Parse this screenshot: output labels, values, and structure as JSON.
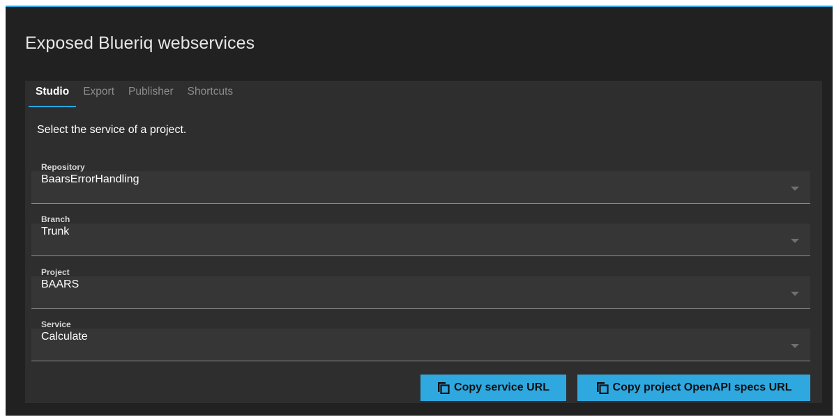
{
  "dialog": {
    "title": "Exposed Blueriq webservices"
  },
  "tabs": [
    {
      "label": "Studio",
      "active": true
    },
    {
      "label": "Export",
      "active": false
    },
    {
      "label": "Publisher",
      "active": false
    },
    {
      "label": "Shortcuts",
      "active": false
    }
  ],
  "studio": {
    "instruction": "Select the service of a project.",
    "fields": {
      "repository": {
        "label": "Repository",
        "value": "BaarsErrorHandling"
      },
      "branch": {
        "label": "Branch",
        "value": "Trunk"
      },
      "project": {
        "label": "Project",
        "value": "BAARS"
      },
      "service": {
        "label": "Service",
        "value": "Calculate"
      }
    },
    "buttons": {
      "copy_service_url": {
        "label": "Copy service URL",
        "icon": "copy-icon"
      },
      "copy_openapi_url": {
        "label": "Copy project OpenAPI specs URL",
        "icon": "copy-icon"
      }
    }
  },
  "colors": {
    "accent": "#29a8e0",
    "dialog_bg": "#212121",
    "panel_bg": "#2e2e2e",
    "field_bg": "#363636"
  }
}
